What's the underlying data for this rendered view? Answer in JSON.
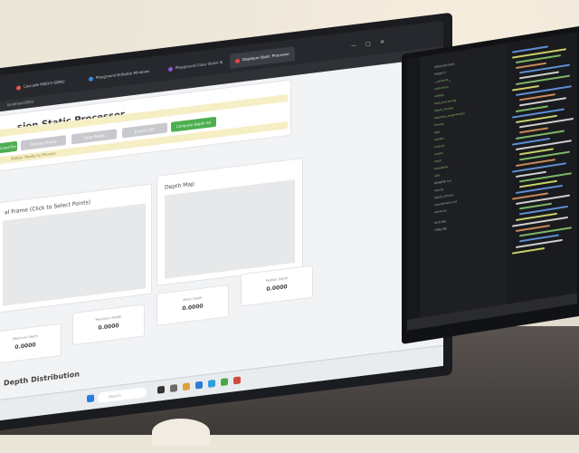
{
  "browser": {
    "tabs": [
      {
        "label": "Cascade MSEV3 DEMO",
        "color": "#e05a47"
      },
      {
        "label": "Playground Editable Windows",
        "color": "#3f8ae0"
      },
      {
        "label": "Playground Class Vision Si",
        "color": "#8a57d1"
      },
      {
        "label": "Depthpro Static Processor",
        "color": "#e04646"
      }
    ],
    "address": "localhost:8501"
  },
  "app": {
    "title": "sion Static Processor",
    "buttons": [
      "Load File",
      "Process Frame",
      "Clear Points",
      "Export CSV",
      "Compute Depth All"
    ],
    "status": "Status: Ready to Process",
    "original_frame_label": "al Frame (Click to Select Points)",
    "depth_map_label": "Depth Map",
    "metrics": [
      {
        "label": "Minimum Depth",
        "value": "0.0000"
      },
      {
        "label": "Maximum Depth",
        "value": "0.0000"
      },
      {
        "label": "Mean Depth",
        "value": "0.0000"
      },
      {
        "label": "Median Depth",
        "value": "0.0000"
      }
    ],
    "depth_distribution": "Depth Distribution"
  },
  "taskbar": {
    "search_placeholder": "Search"
  },
  "ide": {
    "tree": [
      {
        "label": "OPEN EDITORS",
        "color": "#a9b0bd"
      },
      {
        "label": "PROJECT",
        "color": "#a9b0bd"
      },
      {
        "label": "__pycache__",
        "color": "#86c16a"
      },
      {
        "label": "calibration",
        "color": "#86c16a"
      },
      {
        "label": "configs",
        "color": "#86c16a"
      },
      {
        "label": "data_processing",
        "color": "#86c16a"
      },
      {
        "label": "depth_models",
        "color": "#86c16a"
      },
      {
        "label": "depthpro_experiments",
        "color": "#86c16a"
      },
      {
        "label": "frames",
        "color": "#86c16a"
      },
      {
        "label": "logs",
        "color": "#86c16a"
      },
      {
        "label": "models",
        "color": "#86c16a"
      },
      {
        "label": "outputs",
        "color": "#86c16a"
      },
      {
        "label": "scripts",
        "color": "#86c16a"
      },
      {
        "label": "static",
        "color": "#86c16a"
      },
      {
        "label": "templates",
        "color": "#86c16a"
      },
      {
        "label": "utils",
        "color": "#86c16a"
      },
      {
        "label": "README.md",
        "color": "#a9b0bd"
      },
      {
        "label": "app.py",
        "color": "#a9b0bd"
      },
      {
        "label": "depth_utils.py",
        "color": "#a9b0bd"
      },
      {
        "label": "requirements.txt",
        "color": "#a9b0bd"
      },
      {
        "label": "server.py",
        "color": "#a9b0bd"
      },
      {
        "label": "OUTLINE",
        "color": "#a9b0bd"
      },
      {
        "label": "TIMELINE",
        "color": "#a9b0bd"
      }
    ]
  },
  "colors": {
    "accent_green": "#4caf50",
    "alert_yellow": "#f6eec4"
  }
}
